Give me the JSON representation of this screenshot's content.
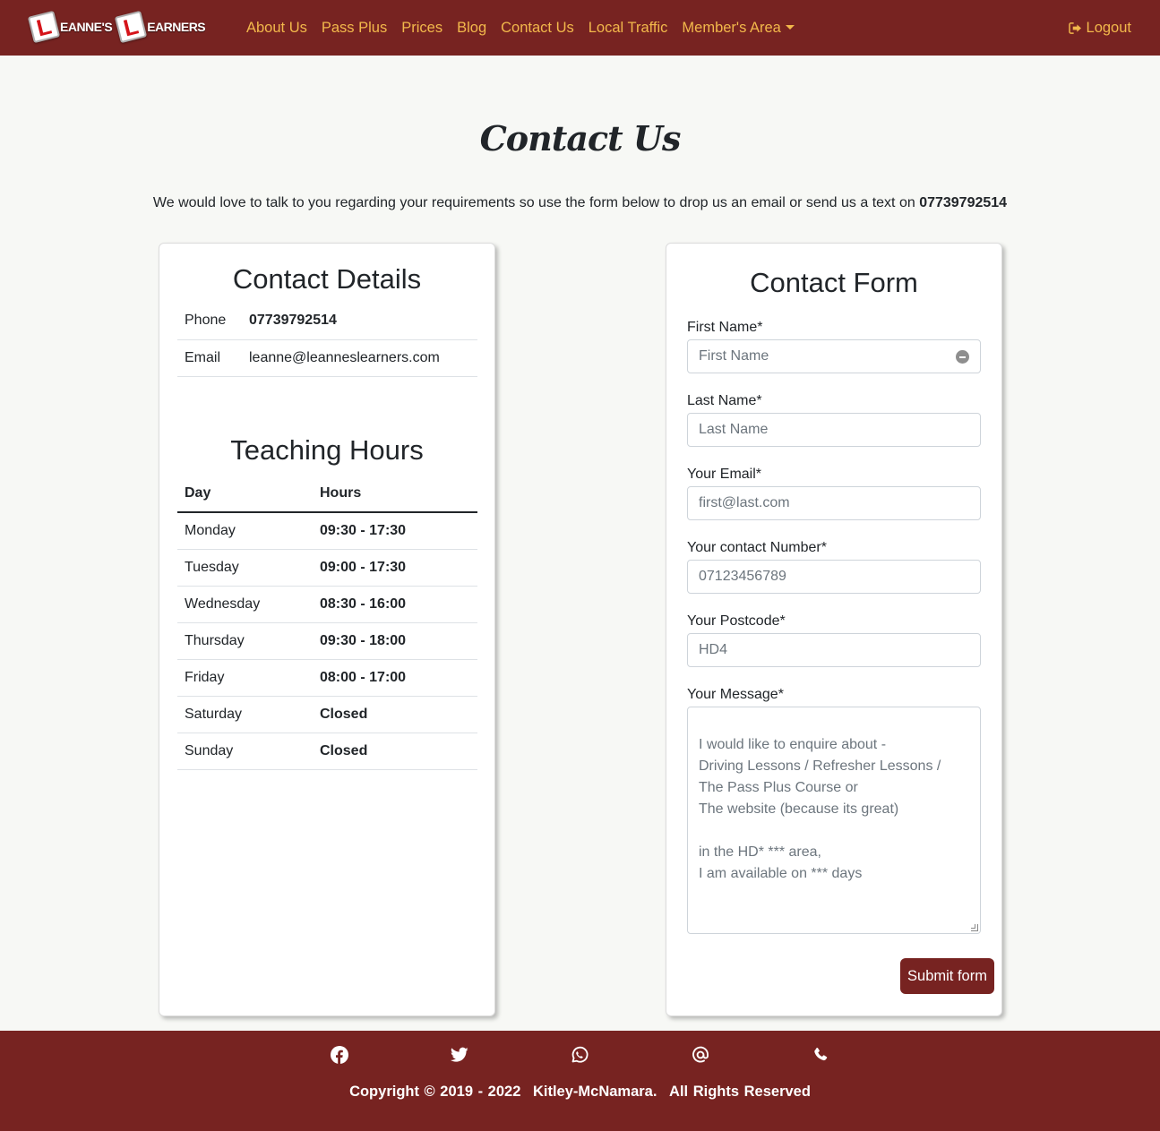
{
  "brand": {
    "word1": "EANNE'S",
    "word2": "EARNERS",
    "plate_letter": "L"
  },
  "nav": {
    "items": [
      "About Us",
      "Pass Plus",
      "Prices",
      "Blog",
      "Contact Us",
      "Local Traffic"
    ],
    "dropdown_label": "Member's Area",
    "logout_label": "Logout",
    "text_color": "#f2b84b",
    "bg_color": "#772321"
  },
  "page": {
    "title": "Contact Us",
    "intro": "We would love to talk to you regarding your requirements so use the form below to drop us an email or send us a text on",
    "intro_phone": "07739792514"
  },
  "contact_details": {
    "heading": "Contact Details",
    "rows": [
      {
        "label": "Phone",
        "value": "07739792514"
      },
      {
        "label": "Email",
        "value": "leanne@leanneslearners.com"
      }
    ]
  },
  "teaching_hours": {
    "heading": "Teaching Hours",
    "columns": [
      "Day",
      "Hours"
    ],
    "rows": [
      {
        "day": "Monday",
        "hours": "09:30 - 17:30"
      },
      {
        "day": "Tuesday",
        "hours": "09:00 - 17:30"
      },
      {
        "day": "Wednesday",
        "hours": "08:30 - 16:00"
      },
      {
        "day": "Thursday",
        "hours": "09:30 - 18:00"
      },
      {
        "day": "Friday",
        "hours": "08:00 - 17:00"
      },
      {
        "day": "Saturday",
        "hours": "Closed"
      },
      {
        "day": "Sunday",
        "hours": "Closed"
      }
    ]
  },
  "contact_form": {
    "heading": "Contact Form",
    "fields": {
      "first_name": {
        "label": "First Name*",
        "placeholder": "First Name"
      },
      "last_name": {
        "label": "Last Name*",
        "placeholder": "Last Name"
      },
      "email": {
        "label": "Your Email*",
        "placeholder": "first@last.com"
      },
      "phone": {
        "label": "Your contact Number*",
        "placeholder": "07123456789"
      },
      "postcode": {
        "label": "Your Postcode*",
        "placeholder": "HD4"
      },
      "message": {
        "label": "Your Message*",
        "placeholder": "I would like to enquire about -\nDriving Lessons / Refresher Lessons /\nThe Pass Plus Course or\nThe website (because its great)\n\nin the HD* *** area,\nI am available on *** days"
      }
    },
    "submit_label": "Submit form"
  },
  "footer": {
    "social_icons": [
      "facebook-icon",
      "twitter-icon",
      "whatsapp-icon",
      "at-email-icon",
      "phone-icon"
    ],
    "copyright": "Copyright © 2019 - 2022",
    "owner": "Kitley-McNamara.",
    "rights": "All Rights Reserved"
  }
}
